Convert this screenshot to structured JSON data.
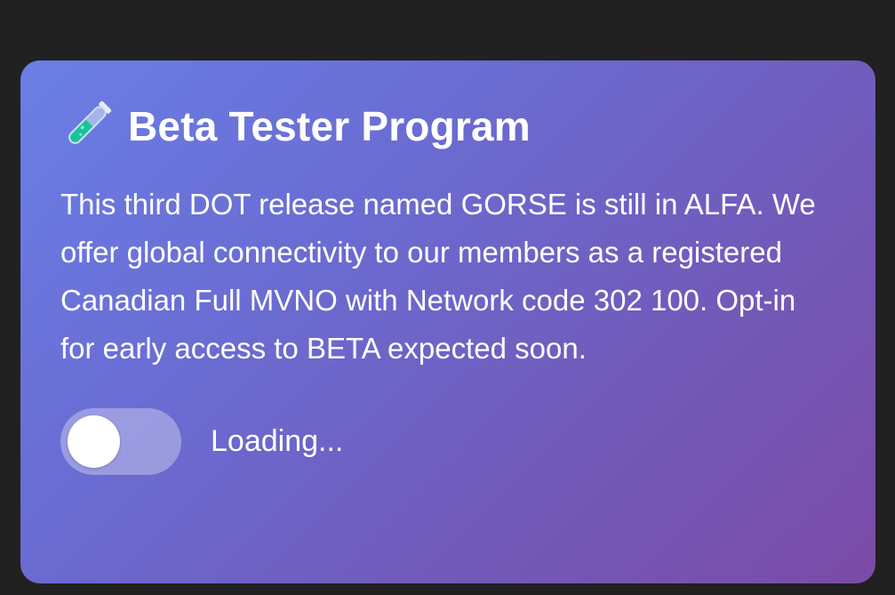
{
  "card": {
    "icon": "test-tube-icon",
    "title": "Beta Tester Program",
    "description": "This third DOT release named GORSE is still in ALFA. We offer global connectivity to our members as a registered Canadian Full MVNO with Network code 302 100. Opt-in for early access to BETA expected soon.",
    "toggle": {
      "state": "off",
      "status_label": "Loading..."
    }
  },
  "colors": {
    "page_background": "#212121",
    "card_gradient_start": "#6a7fe6",
    "card_gradient_end": "#7b4ba7",
    "text": "#ffffff"
  }
}
